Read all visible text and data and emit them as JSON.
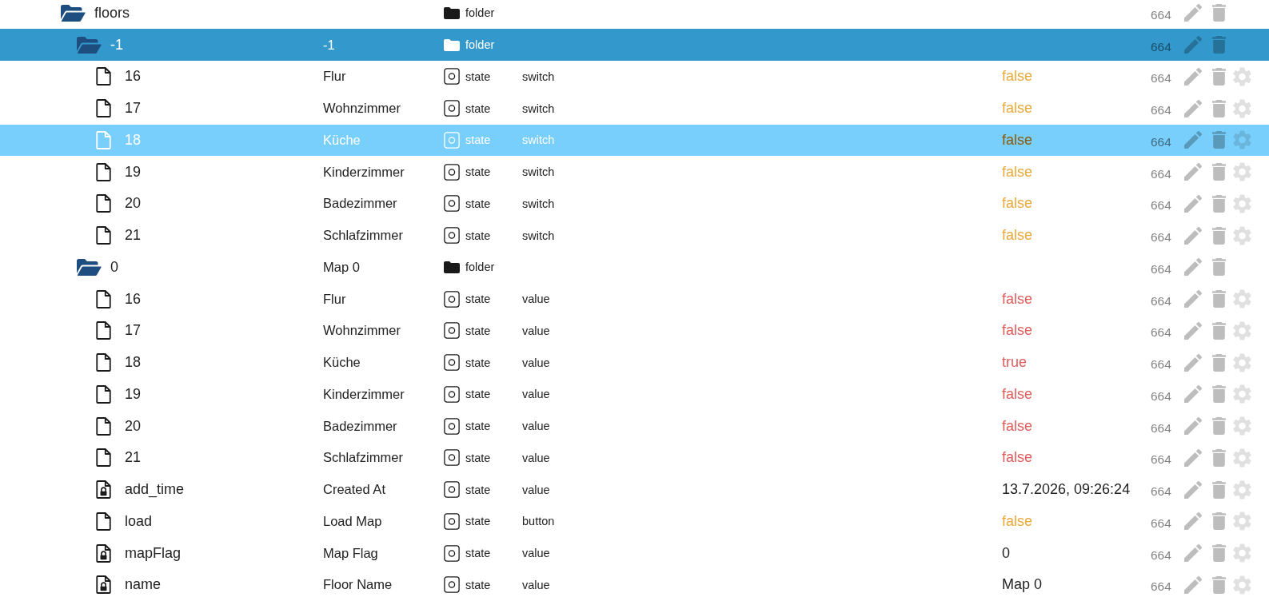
{
  "tree": [
    {
      "kind": "folder",
      "id": "floors",
      "type": "folder",
      "acl": "664",
      "expanded": true,
      "selected": false,
      "hovered": false,
      "children": [
        {
          "kind": "folder",
          "id": "-1",
          "name": "-1",
          "type": "folder",
          "acl": "664",
          "expanded": true,
          "selected": true,
          "hovered": false,
          "children": [
            {
              "kind": "state",
              "id": "16",
              "name": "Flur",
              "type": "state",
              "role": "switch",
              "value": {
                "text": "false",
                "color": "#eba83b"
              },
              "acl": "664",
              "read_only": false,
              "selected": false,
              "hovered": false
            },
            {
              "kind": "state",
              "id": "17",
              "name": "Wohnzimmer",
              "type": "state",
              "role": "switch",
              "value": {
                "text": "false",
                "color": "#eba83b"
              },
              "acl": "664",
              "read_only": false,
              "selected": false,
              "hovered": false
            },
            {
              "kind": "state",
              "id": "18",
              "name": "Küche",
              "type": "state",
              "role": "switch",
              "value": {
                "text": "false",
                "color": "#8a5a08"
              },
              "acl": "664",
              "read_only": false,
              "selected": false,
              "hovered": true
            },
            {
              "kind": "state",
              "id": "19",
              "name": "Kinderzimmer",
              "type": "state",
              "role": "switch",
              "value": {
                "text": "false",
                "color": "#eba83b"
              },
              "acl": "664",
              "read_only": false,
              "selected": false,
              "hovered": false
            },
            {
              "kind": "state",
              "id": "20",
              "name": "Badezimmer",
              "type": "state",
              "role": "switch",
              "value": {
                "text": "false",
                "color": "#eba83b"
              },
              "acl": "664",
              "read_only": false,
              "selected": false,
              "hovered": false
            },
            {
              "kind": "state",
              "id": "21",
              "name": "Schlafzimmer",
              "type": "state",
              "role": "switch",
              "value": {
                "text": "false",
                "color": "#eba83b"
              },
              "acl": "664",
              "read_only": false,
              "selected": false,
              "hovered": false
            }
          ]
        },
        {
          "kind": "folder",
          "id": "0",
          "name": "Map 0",
          "type": "folder",
          "acl": "664",
          "expanded": true,
          "selected": false,
          "hovered": false,
          "children": [
            {
              "kind": "state",
              "id": "16",
              "name": "Flur",
              "type": "state",
              "role": "value",
              "value": {
                "text": "false",
                "color": "#e05c5c"
              },
              "acl": "664",
              "read_only": false,
              "selected": false,
              "hovered": false
            },
            {
              "kind": "state",
              "id": "17",
              "name": "Wohnzimmer",
              "type": "state",
              "role": "value",
              "value": {
                "text": "false",
                "color": "#e05c5c"
              },
              "acl": "664",
              "read_only": false,
              "selected": false,
              "hovered": false
            },
            {
              "kind": "state",
              "id": "18",
              "name": "Küche",
              "type": "state",
              "role": "value",
              "value": {
                "text": "true",
                "color": "#e05c5c"
              },
              "acl": "664",
              "read_only": false,
              "selected": false,
              "hovered": false
            },
            {
              "kind": "state",
              "id": "19",
              "name": "Kinderzimmer",
              "type": "state",
              "role": "value",
              "value": {
                "text": "false",
                "color": "#e05c5c"
              },
              "acl": "664",
              "read_only": false,
              "selected": false,
              "hovered": false
            },
            {
              "kind": "state",
              "id": "20",
              "name": "Badezimmer",
              "type": "state",
              "role": "value",
              "value": {
                "text": "false",
                "color": "#e05c5c"
              },
              "acl": "664",
              "read_only": false,
              "selected": false,
              "hovered": false
            },
            {
              "kind": "state",
              "id": "21",
              "name": "Schlafzimmer",
              "type": "state",
              "role": "value",
              "value": {
                "text": "false",
                "color": "#e05c5c"
              },
              "acl": "664",
              "read_only": false,
              "selected": false,
              "hovered": false
            },
            {
              "kind": "state",
              "id": "add_time",
              "name": "Created At",
              "type": "state",
              "role": "value",
              "value": {
                "text": "13.7.2026, 09:26:24",
                "color": "#222222"
              },
              "acl": "664",
              "read_only": true,
              "selected": false,
              "hovered": false
            },
            {
              "kind": "state",
              "id": "load",
              "name": "Load Map",
              "type": "state",
              "role": "button",
              "value": {
                "text": "false",
                "color": "#eba83b"
              },
              "acl": "664",
              "read_only": false,
              "selected": false,
              "hovered": false
            },
            {
              "kind": "state",
              "id": "mapFlag",
              "name": "Map Flag",
              "type": "state",
              "role": "value",
              "value": {
                "text": "0",
                "color": "#222222"
              },
              "acl": "664",
              "read_only": true,
              "selected": false,
              "hovered": false
            },
            {
              "kind": "state",
              "id": "name",
              "name": "Floor Name",
              "type": "state",
              "role": "value",
              "value": {
                "text": "Map 0",
                "color": "#222222"
              },
              "acl": "664",
              "read_only": true,
              "selected": false,
              "hovered": false
            }
          ]
        }
      ]
    }
  ]
}
